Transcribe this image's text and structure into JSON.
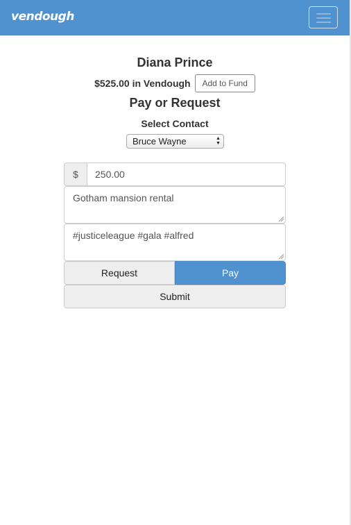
{
  "navbar": {
    "brand": "vendough",
    "toggle_icon": "hamburger-menu-icon",
    "background": "#5092cf"
  },
  "profile": {
    "name": "Diana Prince",
    "balance_text": "$525.00 in Vendough",
    "add_fund_label": "Add to Fund"
  },
  "form": {
    "heading": "Pay or Request",
    "contact_label": "Select Contact",
    "selected_contact": "Bruce Wayne",
    "currency_symbol": "$",
    "amount": "250.00",
    "note": "Gotham mansion rental",
    "tags": "#justiceleague #gala #alfred",
    "request_label": "Request",
    "pay_label": "Pay",
    "active_mode": "Pay",
    "submit_label": "Submit",
    "accent_color": "#5092cf"
  }
}
